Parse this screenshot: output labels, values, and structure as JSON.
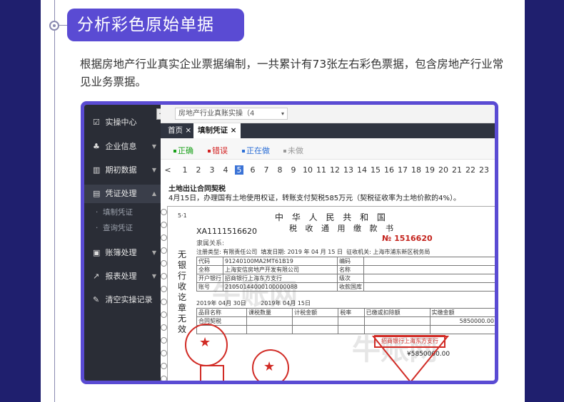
{
  "section": {
    "title": "分析彩色原始单据",
    "description": "根据房地产行业真实企业票据编制，一共累计有73张左右彩色票据，包含房地产行业常见业务票据。"
  },
  "app": {
    "sidebar": {
      "items": [
        {
          "icon": "checkbox-icon",
          "label": "实操中心"
        },
        {
          "icon": "people-icon",
          "label": "企业信息"
        },
        {
          "icon": "bar-chart-icon",
          "label": "期初数据"
        },
        {
          "icon": "document-icon",
          "label": "凭证处理"
        },
        {
          "icon": "ledger-icon",
          "label": "账簿处理"
        },
        {
          "icon": "line-chart-icon",
          "label": "报表处理"
        },
        {
          "icon": "brush-icon",
          "label": "清空实操记录"
        }
      ],
      "sub_items": [
        "填制凭证",
        "查询凭证"
      ],
      "collapse_icon": "collapse-icon"
    },
    "company_select": {
      "value": "房地产行业真账实操（4"
    },
    "tabs": [
      {
        "label": "首页"
      },
      {
        "label": "填制凭证"
      }
    ],
    "legend": [
      {
        "label": "正确",
        "color": "#19a019"
      },
      {
        "label": "错误",
        "color": "#d32323"
      },
      {
        "label": "正在做",
        "color": "#2c6fd6"
      },
      {
        "label": "未做",
        "color": "#9a9a9a"
      }
    ],
    "pager": {
      "prev": "<",
      "pages": [
        "1",
        "2",
        "3",
        "4",
        "5",
        "6",
        "7",
        "8",
        "9",
        "10",
        "11",
        "12",
        "13",
        "14",
        "15",
        "16",
        "17",
        "18",
        "19",
        "20",
        "21",
        "22",
        "23"
      ],
      "current": "5"
    },
    "prompt": {
      "title": "土地出让合同契税",
      "text": "4月15日，办理国有土地使用权证，转账支付契税585万元（契税征收率为土地价款的4%）。"
    },
    "ticket": {
      "title": "中 华 人 民 共 和 国",
      "subtitle": "税 收 通 用 缴 款 书",
      "code": "XA1111516620",
      "number": "№ 1516620",
      "page_mark": "5·1",
      "affiliation": "隶属关系:",
      "reg_type": "注册类型: 有限责任公司",
      "fill_date": "填发日期: 2019 年 04 月 15 日",
      "authority": "征收机关: 上海市浦东新区税务局",
      "side_text": "无银行收讫章无效",
      "credit_code": "91240100MA2MT61B19",
      "company": "上海安信房地产开发有限公司",
      "bank": "招商银行上海东方支行",
      "account": "21050144000100000088",
      "bank_stamp": "招商银行上海东方支行",
      "amount": "5850000.00",
      "amount_total": "¥5850000.00",
      "tax_item": "合同契税",
      "period": "2019年 04月 30日",
      "deadline": "2019年 04月 15日",
      "watermark": "牛账网"
    }
  }
}
